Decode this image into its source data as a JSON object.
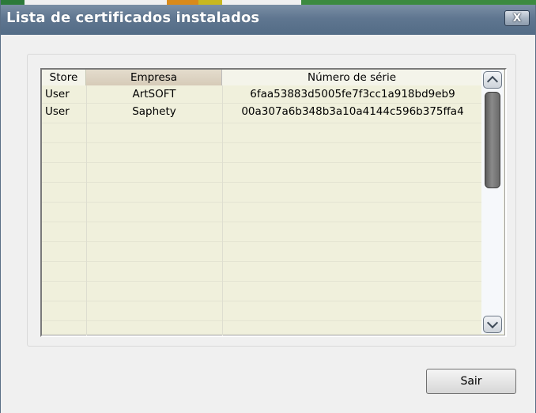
{
  "window": {
    "title": "Lista de certificados instalados",
    "close_label": "X"
  },
  "list": {
    "columns": [
      "Store",
      "Empresa",
      "Número de série"
    ],
    "rows": [
      {
        "store": "User",
        "empresa": "ArtSOFT",
        "serial": "6faa53883d5005fe7f3cc1a918bd9eb9"
      },
      {
        "store": "User",
        "empresa": "Saphety",
        "serial": "00a307a6b348b3a10a4144c596b375ffa4"
      }
    ]
  },
  "buttons": {
    "exit_label": "Sair"
  },
  "icons": {
    "scroll_up": "chevron-up-icon",
    "scroll_down": "chevron-down-icon"
  },
  "colors": {
    "titlebar": "#5f7690",
    "list_background": "#f0f0dc"
  }
}
